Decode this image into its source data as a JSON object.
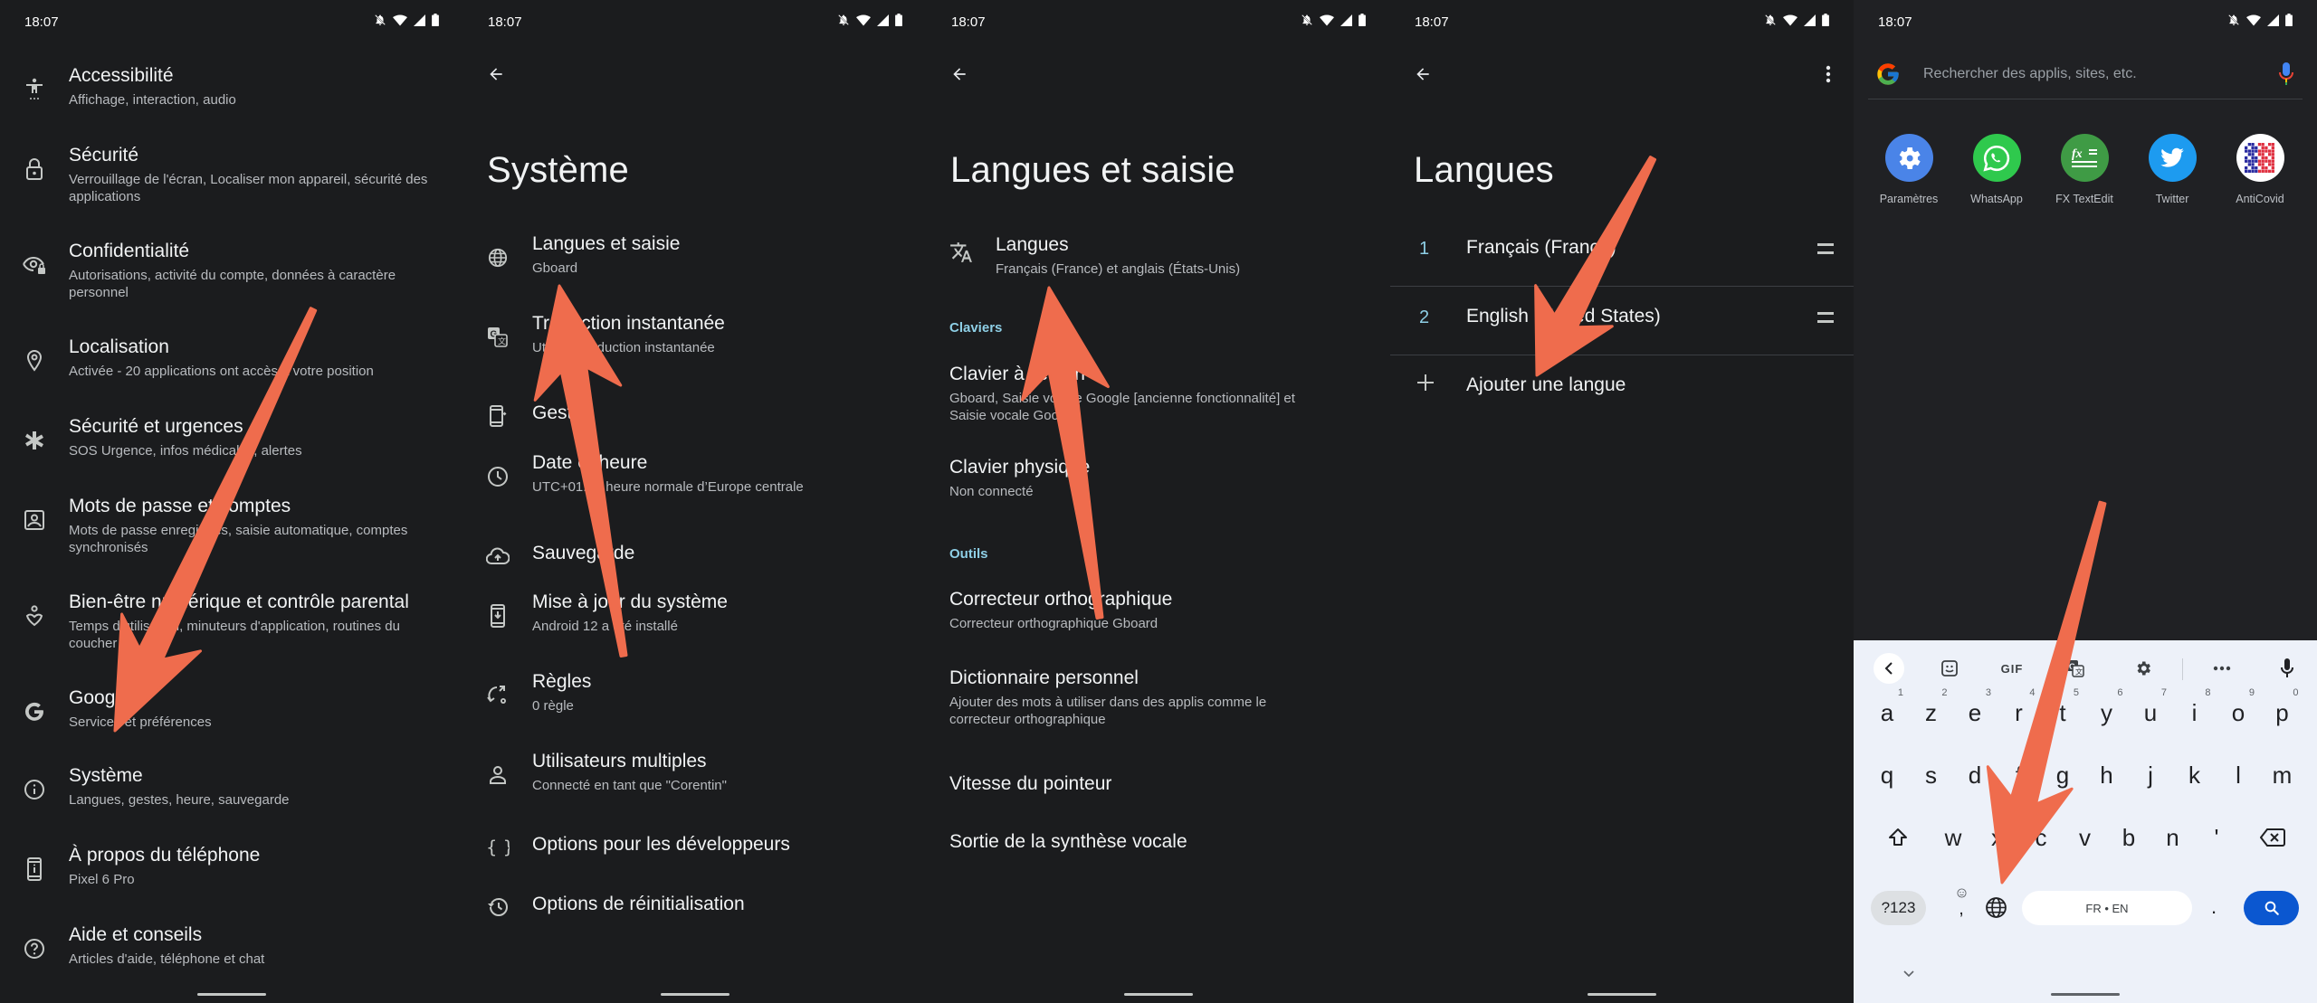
{
  "status_bar": {
    "time": "18:07",
    "icons": [
      "bell-off-icon",
      "wifi-icon",
      "signal-icon",
      "battery-icon"
    ]
  },
  "panels": {
    "settings": {
      "items": [
        {
          "icon": "accessibility-icon",
          "title": "Accessibilité",
          "subtitle": "Affichage, interaction, audio"
        },
        {
          "icon": "lock-icon",
          "title": "Sécurité",
          "subtitle": "Verrouillage de l'écran, Localiser mon appareil, sécurité des applications"
        },
        {
          "icon": "privacy-eye-icon",
          "title": "Confidentialité",
          "subtitle": "Autorisations, activité du compte, données à caractère personnel"
        },
        {
          "icon": "location-pin-icon",
          "title": "Localisation",
          "subtitle": "Activée - 20 applications ont accès à votre position"
        },
        {
          "icon": "emergency-asterisk-icon",
          "title": "Sécurité et urgences",
          "subtitle": "SOS Urgence, infos médicales, alertes"
        },
        {
          "icon": "account-box-icon",
          "title": "Mots de passe et comptes",
          "subtitle": "Mots de passe enregistrés, saisie automatique, comptes synchronisés"
        },
        {
          "icon": "wellbeing-icon",
          "title": "Bien-être numérique et contrôle parental",
          "subtitle": "Temps d'utilisation, minuteurs d'application, routines du coucher"
        },
        {
          "icon": "google-g-icon",
          "title": "Google",
          "subtitle": "Services et préférences"
        },
        {
          "icon": "info-icon",
          "title": "Système",
          "subtitle": "Langues, gestes, heure, sauvegarde"
        },
        {
          "icon": "phone-info-icon",
          "title": "À propos du téléphone",
          "subtitle": "Pixel 6 Pro"
        },
        {
          "icon": "help-icon",
          "title": "Aide et conseils",
          "subtitle": "Articles d'aide, téléphone et chat"
        }
      ]
    },
    "system": {
      "title": "Système",
      "items": [
        {
          "icon": "globe-icon",
          "title": "Langues et saisie",
          "subtitle": "Gboard"
        },
        {
          "icon": "translate-icon",
          "title": "Traduction instantanée",
          "subtitle": "Utiliser Traduction instantanée"
        },
        {
          "icon": "gestures-icon",
          "title": "Gestes",
          "subtitle": ""
        },
        {
          "icon": "clock-icon",
          "title": "Date et heure",
          "subtitle": "UTC+01:00 heure normale d’Europe centrale"
        },
        {
          "icon": "cloud-upload-icon",
          "title": "Sauvegarde",
          "subtitle": ""
        },
        {
          "icon": "system-update-icon",
          "title": "Mise à jour du système",
          "subtitle": "Android 12 a été installé"
        },
        {
          "icon": "rules-icon",
          "title": "Règles",
          "subtitle": "0 règle"
        },
        {
          "icon": "person-icon",
          "title": "Utilisateurs multiples",
          "subtitle": "Connecté en tant que \"Corentin\""
        },
        {
          "icon": "braces-icon",
          "title": "Options pour les développeurs",
          "subtitle": ""
        },
        {
          "icon": "history-icon",
          "title": "Options de réinitialisation",
          "subtitle": ""
        }
      ]
    },
    "languages_input": {
      "title": "Langues et saisie",
      "languages_item": {
        "icon": "translate-icon",
        "title": "Langues",
        "subtitle": "Français (France) et anglais (États-Unis)"
      },
      "keyboards_header": "Claviers",
      "keyboards": [
        {
          "title": "Clavier à l'écran",
          "subtitle": "Gboard, Saisie vocale Google [ancienne fonctionnalité] et Saisie vocale Google"
        },
        {
          "title": "Clavier physique",
          "subtitle": "Non connecté"
        }
      ],
      "tools_header": "Outils",
      "tools": [
        {
          "title": "Correcteur orthographique",
          "subtitle": "Correcteur orthographique Gboard"
        },
        {
          "title": "Dictionnaire personnel",
          "subtitle": "Ajouter des mots à utiliser dans des applis comme le correcteur orthographique"
        },
        {
          "title": "Vitesse du pointeur",
          "subtitle": ""
        },
        {
          "title": "Sortie de la synthèse vocale",
          "subtitle": ""
        }
      ]
    },
    "languages": {
      "title": "Langues",
      "list": [
        {
          "num": "1",
          "name": "Français (France)"
        },
        {
          "num": "2",
          "name": "English (United States)"
        }
      ],
      "add_label": "Ajouter une langue"
    },
    "launcher": {
      "search_placeholder": "Rechercher des applis, sites, etc.",
      "apps": [
        {
          "name": "Paramètres",
          "icon": "settings-gear-icon",
          "color": "#4a84e8"
        },
        {
          "name": "WhatsApp",
          "icon": "whatsapp-icon",
          "color": "#2fc94d"
        },
        {
          "name": "FX TextEdit",
          "icon": "fx-textedit-icon",
          "color": "#3f9b45"
        },
        {
          "name": "Twitter",
          "icon": "twitter-bird-icon",
          "color": "#1d9bf0"
        },
        {
          "name": "AntiCovid",
          "icon": "anticovid-qr-icon",
          "color": "#ffffff"
        }
      ],
      "keyboard": {
        "toolbar": {
          "gif": "GIF"
        },
        "row1": [
          {
            "k": "a",
            "n": "1"
          },
          {
            "k": "z",
            "n": "2"
          },
          {
            "k": "e",
            "n": "3"
          },
          {
            "k": "r",
            "n": "4"
          },
          {
            "k": "t",
            "n": "5"
          },
          {
            "k": "y",
            "n": "6"
          },
          {
            "k": "u",
            "n": "7"
          },
          {
            "k": "i",
            "n": "8"
          },
          {
            "k": "o",
            "n": "9"
          },
          {
            "k": "p",
            "n": "0"
          }
        ],
        "row2": [
          "q",
          "s",
          "d",
          "f",
          "g",
          "h",
          "j",
          "k",
          "l",
          "m"
        ],
        "row3": [
          "w",
          "x",
          "c",
          "v",
          "b",
          "n",
          "'"
        ],
        "symbols_key": "?123",
        "comma_key": ",",
        "period_key": ".",
        "space_label": "FR • EN"
      }
    }
  },
  "annotation_color": "#ef6c4d"
}
